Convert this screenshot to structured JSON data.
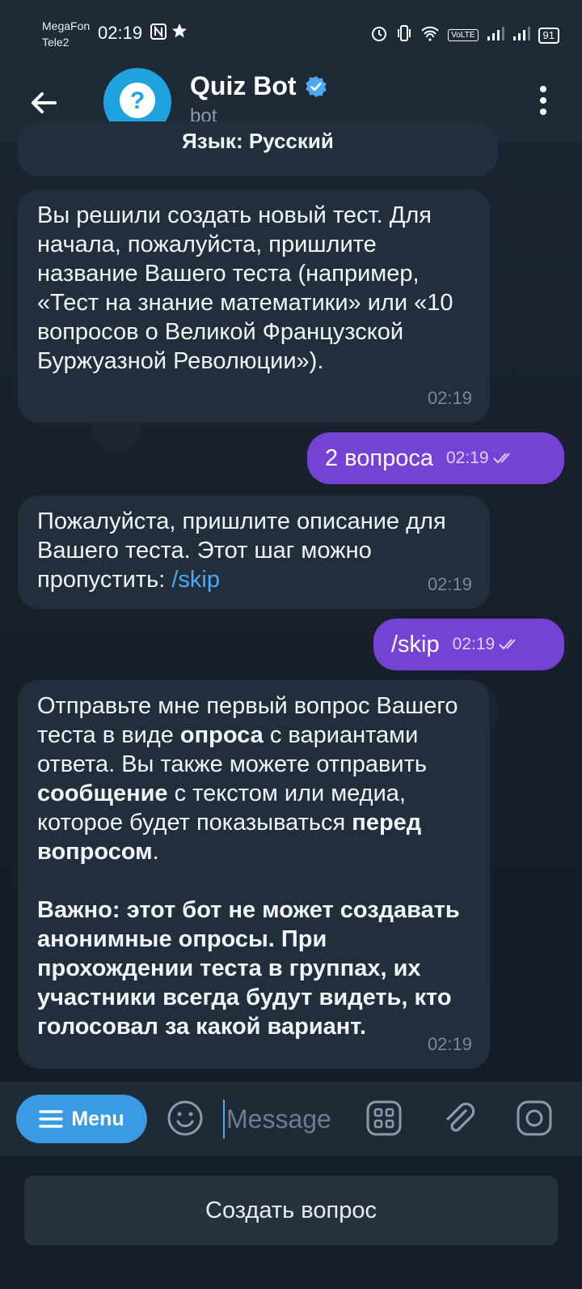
{
  "status_bar": {
    "carrier_1": "MegaFon",
    "carrier_2": "Tele2",
    "time": "02:19",
    "battery": "91",
    "volte": "VoLTE"
  },
  "header": {
    "title": "Quiz Bot",
    "subtitle": "bot"
  },
  "messages": {
    "partial": {
      "text": "Язык: Русский"
    },
    "m1": {
      "text": "Вы решили создать новый тест. Для начала, пожалуйста, пришлите название Вашего теста (например, «Тест на знание математики» или «10 вопросов о Великой Французской Буржуазной Революции»).",
      "time": "02:19"
    },
    "out1": {
      "text": "2 вопроса",
      "time": "02:19"
    },
    "m2": {
      "text": "Пожалуйста, пришлите описание для Вашего теста. Этот шаг можно пропустить: ",
      "link": "/skip",
      "time": "02:19"
    },
    "out2": {
      "text": "/skip",
      "time": "02:19"
    },
    "m3": {
      "p1_a": "Отправьте мне первый вопрос Вашего теста в виде ",
      "p1_b": "опроса",
      "p1_c": " с вариантами ответа. Вы также можете отправить ",
      "p1_d": "сообщение",
      "p1_e": " с текстом или медиа, которое будет показываться ",
      "p1_f": "перед вопросом",
      "p1_g": ".",
      "p2": "Важно: этот бот не может создавать анонимные опросы. При прохождении теста в группах, их участники всегда будут видеть, кто голосовал за какой вариант.",
      "time": "02:19"
    }
  },
  "composer": {
    "menu_label": "Menu",
    "placeholder": "Message"
  },
  "keyboard": {
    "button_label": "Создать вопрос"
  },
  "colors": {
    "outgoing": "#7443d6",
    "incoming": "#222e3b",
    "accent": "#3a9ae3",
    "link": "#4ea8f0"
  }
}
